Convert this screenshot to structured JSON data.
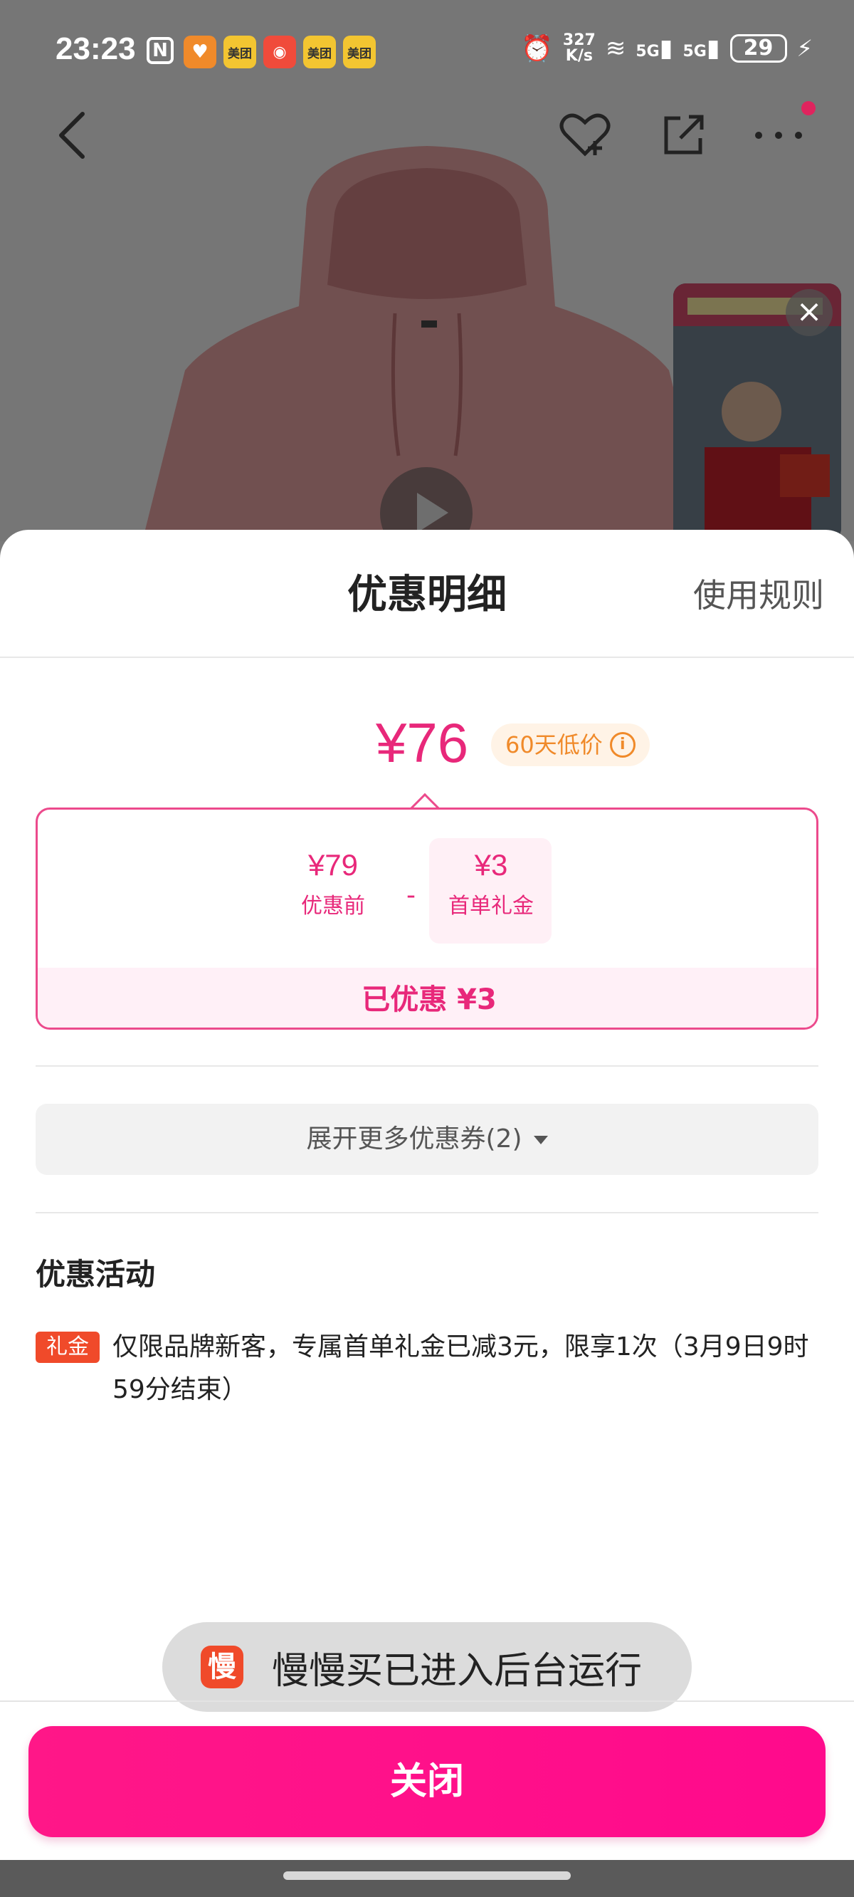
{
  "status_bar": {
    "time": "23:23",
    "nfc": "N",
    "apps": [
      "美团",
      "美团",
      "美团"
    ],
    "net_speed_value": "327",
    "net_speed_unit": "K/s",
    "signal_1": "5G",
    "signal_2": "5G",
    "battery": "29"
  },
  "sheet": {
    "title": "优惠明细",
    "rules_link": "使用规则",
    "final_price": "¥76",
    "low_price_badge": "60天低价",
    "calc": {
      "original_value": "¥79",
      "original_label": "优惠前",
      "minus": "-",
      "gift_value": "¥3",
      "gift_label": "首单礼金",
      "saved": "已优惠 ¥3"
    },
    "expand_label": "展开更多优惠券(2)",
    "promo_section_title": "优惠活动",
    "promo_tag": "礼金",
    "promo_text": "仅限品牌新客，专属首单礼金已减3元，限享1次（3月9日9时59分结束）"
  },
  "toast": {
    "icon": "慢",
    "text": "慢慢买已进入后台运行"
  },
  "close_button": "关闭",
  "colors": {
    "accent": "#e8287a",
    "button": "#ff1788",
    "badge_orange": "#f08a2a",
    "tag_red": "#f04a2a"
  }
}
